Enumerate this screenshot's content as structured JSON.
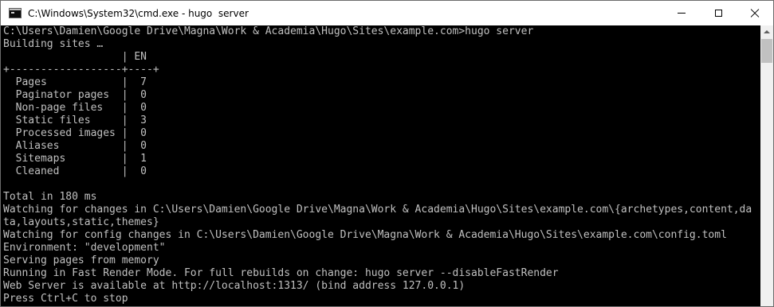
{
  "window": {
    "title": "C:\\Windows\\System32\\cmd.exe - hugo  server",
    "icon": "cmd-icon"
  },
  "console": {
    "lines": [
      "C:\\Users\\Damien\\Google Drive\\Magna\\Work & Academia\\Hugo\\Sites\\example.com>hugo server",
      "Building sites …",
      "                   | EN",
      "+------------------+----+",
      "  Pages            |  7",
      "  Paginator pages  |  0",
      "  Non-page files   |  0",
      "  Static files     |  3",
      "  Processed images |  0",
      "  Aliases          |  0",
      "  Sitemaps         |  1",
      "  Cleaned          |  0",
      "",
      "Total in 180 ms",
      "Watching for changes in C:\\Users\\Damien\\Google Drive\\Magna\\Work & Academia\\Hugo\\Sites\\example.com\\{archetypes,content,da",
      "ta,layouts,static,themes}",
      "Watching for config changes in C:\\Users\\Damien\\Google Drive\\Magna\\Work & Academia\\Hugo\\Sites\\example.com\\config.toml",
      "Environment: \"development\"",
      "Serving pages from memory",
      "Running in Fast Render Mode. For full rebuilds on change: hugo server --disableFastRender",
      "Web Server is available at http://localhost:1313/ (bind address 127.0.0.1)",
      "Press Ctrl+C to stop"
    ]
  },
  "colors": {
    "console_bg": "#000000",
    "console_fg": "#c0c0c0",
    "titlebar_bg": "#ffffff"
  }
}
